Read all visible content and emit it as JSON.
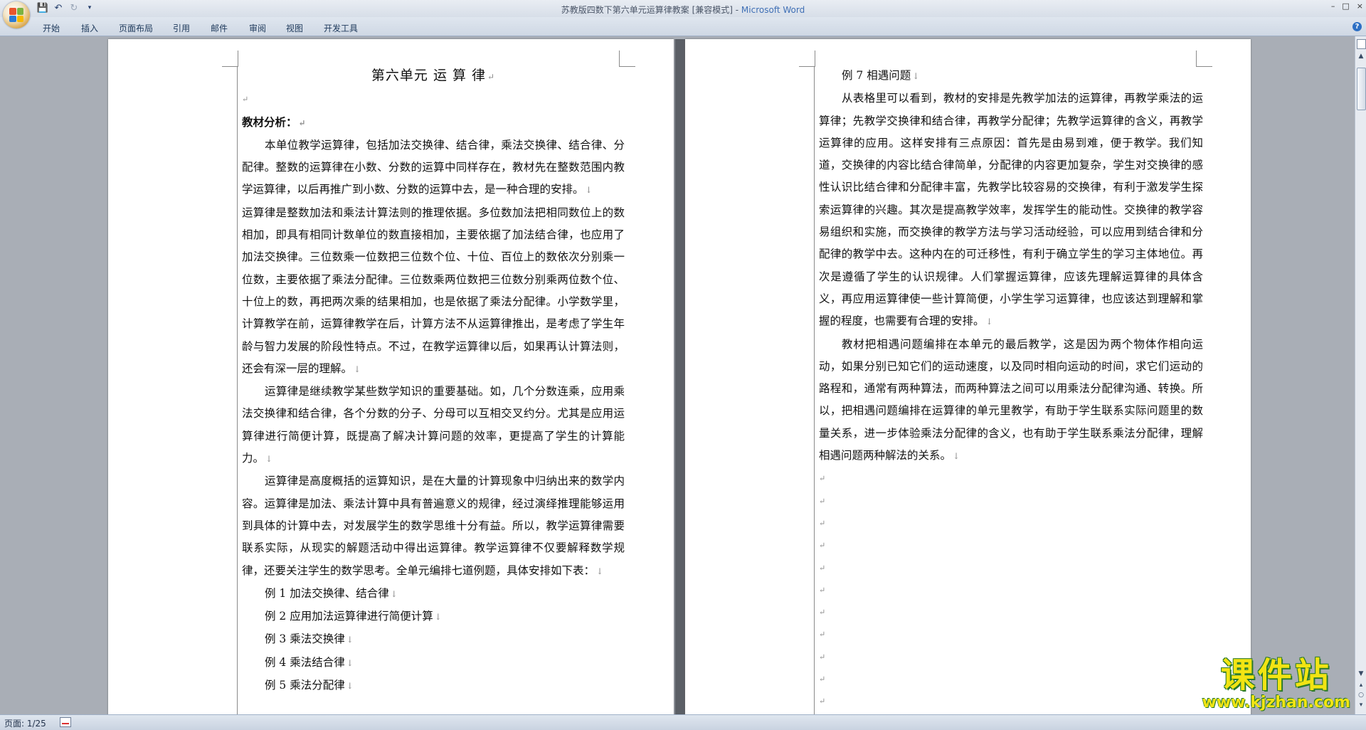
{
  "titlebar": {
    "doc_title": "苏教版四数下第六单元运算律教案 [兼容模式] - ",
    "app_name": "Microsoft Word",
    "quick_access": {
      "save": "💾",
      "undo": "↶",
      "redo": "↻",
      "more": "▾"
    },
    "window_controls": {
      "minimize": "–",
      "maximize": "□",
      "close": "×"
    }
  },
  "ribbon": {
    "tabs": [
      "开始",
      "插入",
      "页面布局",
      "引用",
      "邮件",
      "审阅",
      "视图",
      "开发工具"
    ],
    "help": "?"
  },
  "left_page": {
    "title": "第六单元        运  算  律",
    "section_heading": "教材分析：",
    "paragraphs": [
      "本单位教学运算律，包括加法交换律、结合律，乘法交换律、结合律、分配律。整数的运算律在小数、分数的运算中同样存在，教材先在整数范围内教学运算律，以后再推广到小数、分数的运算中去，是一种合理的安排。",
      "运算律是整数加法和乘法计算法则的推理依据。多位数加法把相同数位上的数相加，即具有相同计数单位的数直接相加，主要依据了加法结合律，也应用了加法交换律。三位数乘一位数把三位数个位、十位、百位上的数依次分别乘一位数，主要依据了乘法分配律。三位数乘两位数把三位数分别乘两位数个位、十位上的数，再把两次乘的结果相加，也是依据了乘法分配律。小学数学里，计算教学在前，运算律教学在后，计算方法不从运算律推出，是考虑了学生年龄与智力发展的阶段性特点。不过，在教学运算律以后，如果再认计算法则，还会有深一层的理解。",
      "运算律是继续教学某些数学知识的重要基础。如，几个分数连乘，应用乘法交换律和结合律，各个分数的分子、分母可以互相交叉约分。尤其是应用运算律进行简便计算，既提高了解决计算问题的效率，更提高了学生的计算能力。",
      "运算律是高度概括的运算知识，是在大量的计算现象中归纳出来的数学内容。运算律是加法、乘法计算中具有普遍意义的规律，经过演绎推理能够运用到具体的计算中去，对发展学生的数学思维十分有益。所以，教学运算律需要联系实际，从现实的解题活动中得出运算律。教学运算律不仅要解释数学规律，还要关注学生的数学思考。全单元编排七道例题，具体安排如下表："
    ],
    "examples": [
      "例 1  加法交换律、结合律",
      "例 2  应用加法运算律进行简便计算",
      "例 3  乘法交换律",
      "例 4  乘法结合律",
      "例 5  乘法分配律"
    ]
  },
  "right_page": {
    "example7": "例 7  相遇问题",
    "paragraphs": [
      "从表格里可以看到，教材的安排是先教学加法的运算律，再教学乘法的运算律；先教学交换律和结合律，再教学分配律；先教学运算律的含义，再教学运算律的应用。这样安排有三点原因：首先是由易到难，便于教学。我们知道，交换律的内容比结合律简单，分配律的内容更加复杂，学生对交换律的感性认识比结合律和分配律丰富，先教学比较容易的交换律，有利于激发学生探索运算律的兴趣。其次是提高教学效率，发挥学生的能动性。交换律的教学容易组织和实施，而交换律的教学方法与学习活动经验，可以应用到结合律和分配律的教学中去。这种内在的可迁移性，有利于确立学生的学习主体地位。再次是遵循了学生的认识规律。人们掌握运算律，应该先理解运算律的具体含义，再应用运算律使一些计算简便，小学生学习运算律，也应该达到理解和掌握的程度，也需要有合理的安排。",
      "教材把相遇问题编排在本单元的最后教学，这是因为两个物体作相向运动，如果分别已知它们的运动速度，以及同时相向运动的时间，求它们运动的路程和，通常有两种算法，而两种算法之间可以用乘法分配律沟通、转换。所以，把相遇问题编排在运算律的单元里教学，有助于学生联系实际问题里的数量关系，进一步体验乘法分配律的含义，也有助于学生联系乘法分配律，理解相遇问题两种解法的关系。"
    ],
    "empty_mark": "↵"
  },
  "marks": {
    "paragraph": "↓",
    "title_end": "↵"
  },
  "statusbar": {
    "page_info": "页面: 1/25"
  },
  "watermark": {
    "text": "课件站",
    "url": "www.kjzhan.com"
  },
  "colors": {
    "accent": "#3f6fb5",
    "watermark_yellow": "#f2e413",
    "watermark_green": "#2a7a2a"
  }
}
